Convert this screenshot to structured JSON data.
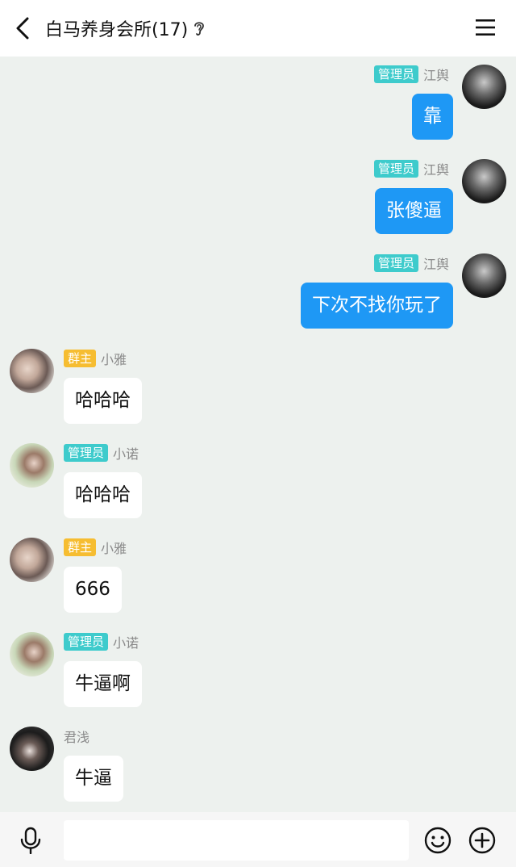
{
  "header": {
    "title": "白马养身会所(17)",
    "icons": {
      "back": "chevron-left-icon",
      "ear": "ear-icon",
      "menu": "hamburger-menu-icon"
    }
  },
  "messages": [
    {
      "side": "right",
      "badge": "管理员",
      "name": "江舆",
      "text": "靠",
      "avatar": "dark"
    },
    {
      "side": "right",
      "badge": "管理员",
      "name": "江舆",
      "text": "张傻逼",
      "avatar": "dark"
    },
    {
      "side": "right",
      "badge": "管理员",
      "name": "江舆",
      "text": "下次不找你玩了",
      "avatar": "dark"
    },
    {
      "side": "left",
      "badge": "群主",
      "name": "小雅",
      "text": "哈哈哈",
      "avatar": "xy"
    },
    {
      "side": "left",
      "badge": "管理员",
      "name": "小诺",
      "text": "哈哈哈",
      "avatar": "xn"
    },
    {
      "side": "left",
      "badge": "群主",
      "name": "小雅",
      "text": "666",
      "avatar": "xy"
    },
    {
      "side": "left",
      "badge": "管理员",
      "name": "小诺",
      "text": "牛逼啊",
      "avatar": "xn"
    },
    {
      "side": "left",
      "badge": "",
      "name": "君浅",
      "text": "牛逼",
      "avatar": "jq"
    }
  ],
  "input": {
    "value": "",
    "placeholder": ""
  },
  "colors": {
    "chat_bg": "#edf1ee",
    "bubble_right": "#1e98f5",
    "badge_admin": "#3ecbcc",
    "badge_owner": "#f6bd31"
  }
}
